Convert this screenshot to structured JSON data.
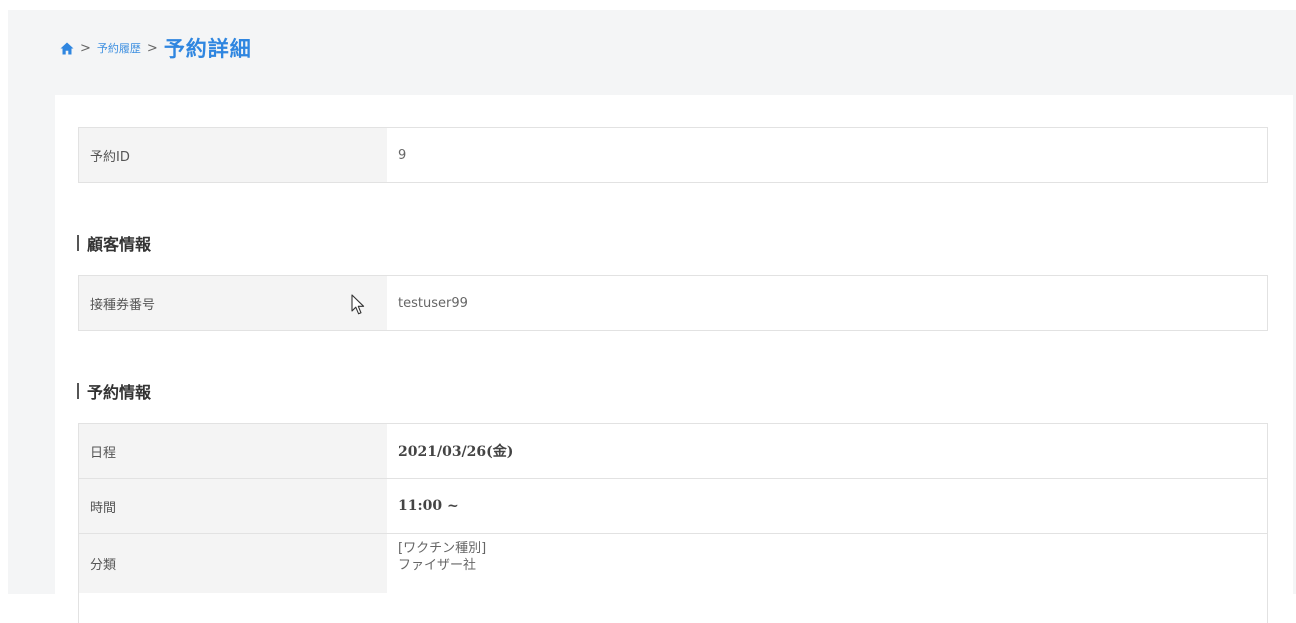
{
  "breadcrumb": {
    "home_icon": "home-icon",
    "separator": ">",
    "history": "予約履歴",
    "current": "予約詳細"
  },
  "reservation_id": {
    "label": "予約ID",
    "value": "9"
  },
  "customer_section": {
    "title": "顧客情報",
    "ticket_label": "接種券番号",
    "ticket_value": "testuser99"
  },
  "reservation_section": {
    "title": "予約情報",
    "date_label": "日程",
    "date_value": "2021/03/26(金)",
    "time_label": "時間",
    "time_value": "11:00 ~",
    "category_label": "分類",
    "category_line1": "[ワクチン種別]",
    "category_line2": "ファイザー社"
  },
  "colors": {
    "accent": "#2f86e0",
    "page_background": "#f4f5f6",
    "label_background": "#f4f4f4"
  }
}
